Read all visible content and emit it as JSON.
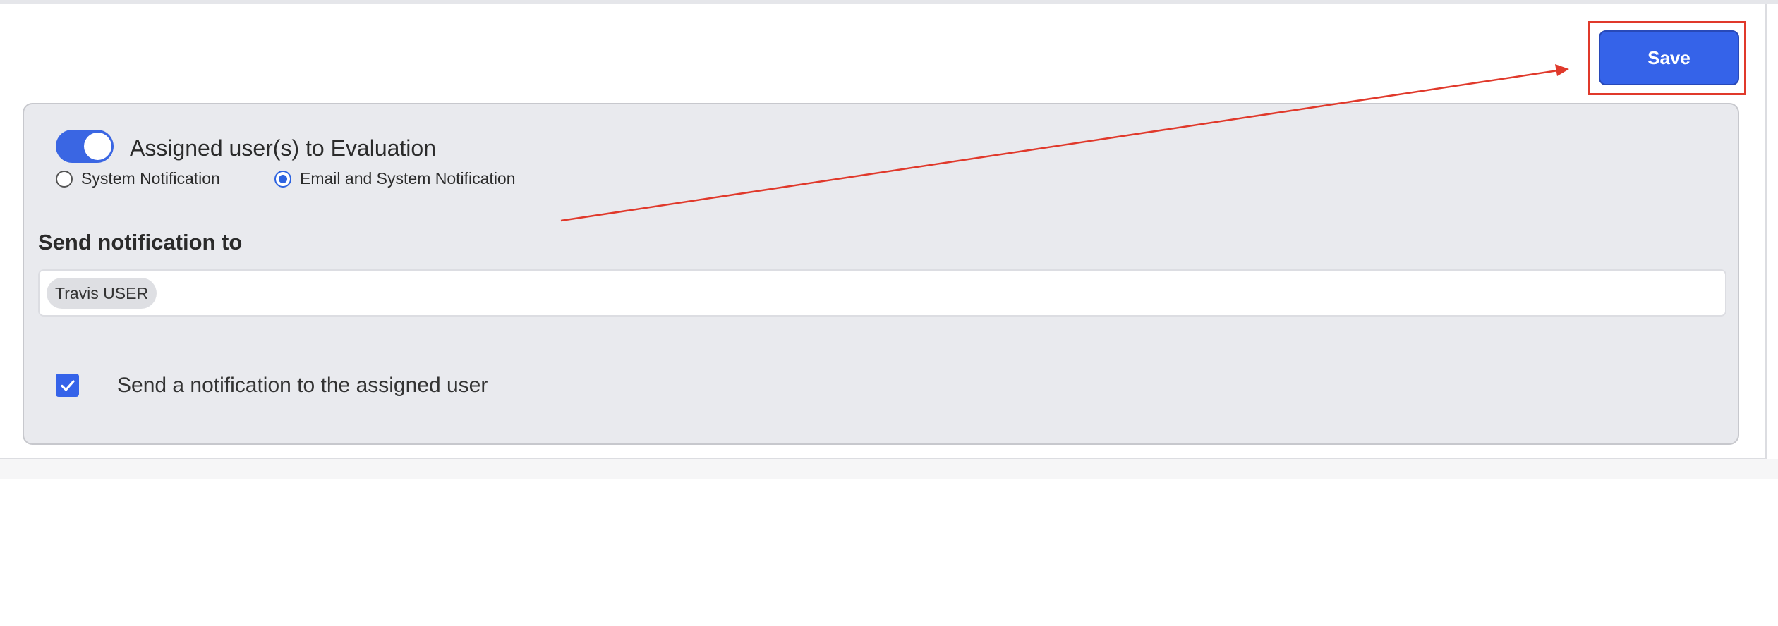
{
  "toolbar": {
    "save_label": "Save"
  },
  "notification": {
    "toggle_label": "Assigned user(s) to Evaluation",
    "toggle_on": true,
    "options": [
      {
        "label": "System Notification",
        "selected": false
      },
      {
        "label": "Email and System Notification",
        "selected": true
      }
    ]
  },
  "recipients": {
    "heading": "Send notification to",
    "chips": [
      "Travis USER"
    ]
  },
  "assigned_user_checkbox": {
    "label": "Send a notification to the assigned user",
    "checked": true
  },
  "colors": {
    "accent": "#3563e9",
    "annotation": "#e0392b",
    "panel_bg": "#e9eaee"
  }
}
